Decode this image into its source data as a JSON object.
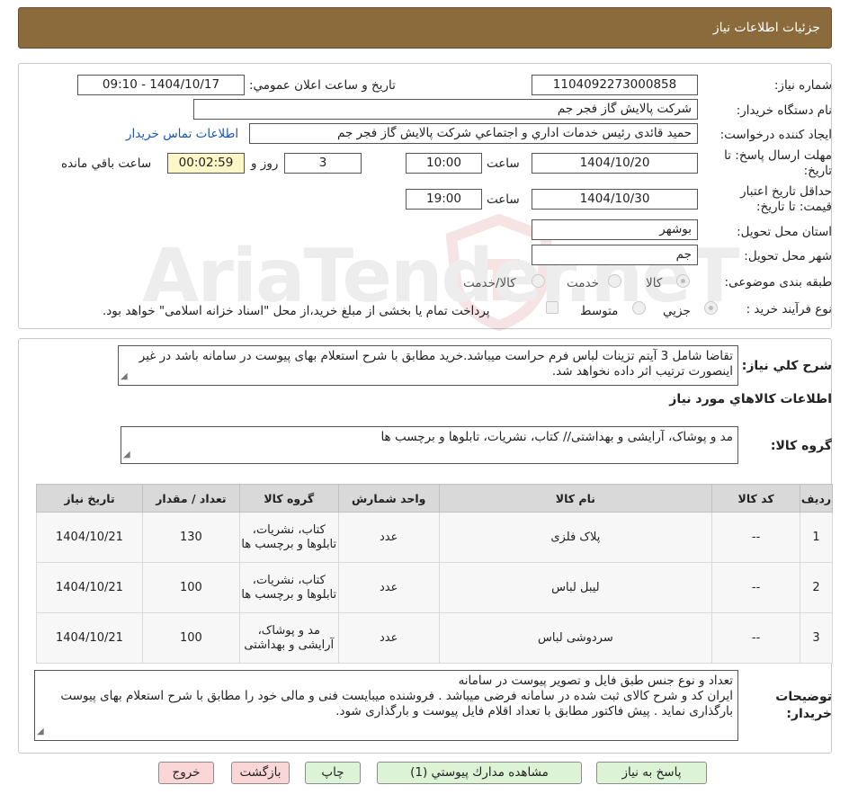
{
  "header": {
    "title": "جزئیات اطلاعات نیاز"
  },
  "form": {
    "need_number_label": "شماره نیاز:",
    "need_number": "1104092273000858",
    "announce_label": "تاریخ و ساعت اعلان عمومي:",
    "announce_value": "1404/10/17 - 09:10",
    "buyer_org_label": "نام دستگاه خريدار:",
    "buyer_org": "شركت پالايش گاز فجر جم",
    "requester_label": "ايجاد كننده درخواست:",
    "requester": "حميد قائدى رئيس خدمات اداري و اجتماعي شركت پالايش گاز فجر جم",
    "contact_link": "اطلاعات تماس خريدار",
    "reply_deadline_label": "مهلت ارسال پاسخ: تا تاریخ:",
    "reply_date": "1404/10/20",
    "time_label": "ساعت",
    "reply_time": "10:00",
    "days_value": "3",
    "days_label": "روز و",
    "remaining_time": "00:02:59",
    "remaining_label": "ساعت باقي مانده",
    "validity_label": "حداقل تاريخ اعتبار قيمت: تا تاريخ:",
    "validity_date": "1404/10/30",
    "validity_time": "19:00",
    "province_label": "استان محل تحويل:",
    "province": "بوشهر",
    "city_label": "شهر محل تحويل:",
    "city": "جم",
    "category_label": "طبقه بندی موضوعی:",
    "category_options": [
      "كالا",
      "خدمت",
      "كالا/خدمت"
    ],
    "process_label": "نوع فرآيند خريد :",
    "process_options": [
      "جزيي",
      "متوسط"
    ],
    "payment_note": "پرداخت تمام يا بخشى از مبلغ خريد،از محل \"اسناد خزانه اسلامى\" خواهد بود."
  },
  "description": {
    "label": "شرح كلي نياز:",
    "text": "تقاضا شامل 3 آیتم تزینات لباس فرم حراست میباشد.خرید مطابق با شرح استعلام بهای پیوست در سامانه باشد در غیر اینصورت ترتیب اثر داده نخواهد شد."
  },
  "goods": {
    "section_title": "اطلاعات كالاهاي مورد نياز",
    "group_label": "گروه كالا:",
    "group_value": "مد و پوشاک، آرایشی و بهداشتی// کتاب، نشریات، تابلوها و برچسب ها",
    "columns": [
      "رديف",
      "كد كالا",
      "نام كالا",
      "واحد شمارش",
      "گروه كالا",
      "تعداد / مقدار",
      "تاريخ نياز"
    ],
    "rows": [
      {
        "row": "1",
        "code": "--",
        "name": "پلاک فلزی",
        "unit": "عدد",
        "group": "کتاب، نشریات، تابلوها و برچسب ها",
        "qty": "130",
        "date": "1404/10/21"
      },
      {
        "row": "2",
        "code": "--",
        "name": "لیبل لباس",
        "unit": "عدد",
        "group": "کتاب، نشریات، تابلوها و برچسب ها",
        "qty": "100",
        "date": "1404/10/21"
      },
      {
        "row": "3",
        "code": "--",
        "name": "سردوشی لباس",
        "unit": "عدد",
        "group": "مد و پوشاک، آرایشی و بهداشتی",
        "qty": "100",
        "date": "1404/10/21"
      }
    ]
  },
  "buyer_notes": {
    "label": "توضيحات خريدار:",
    "line1": "تعداد و نوع جنس طبق فایل و تصویر پیوست در سامانه",
    "line2": "ایران کد و شرح کالای ثبت شده در سامانه فرضی میباشد . فروشنده میبایست فنی و مالی خود را مطابق با شرح استعلام بهای پیوست بارگذاری نماید . پیش فاکتور مطابق با تعداد اقلام فایل پیوست و بارگذاری شود."
  },
  "buttons": {
    "reply": "پاسخ به نياز",
    "attachments": "مشاهده مدارك پيوستي (1)",
    "print": "چاپ",
    "back": "بازگشت",
    "exit": "خروج"
  },
  "watermark": {
    "text": "AriaTender.neT"
  },
  "colors": {
    "header": "#8b6a3c",
    "button_green": "#ddf3d5",
    "button_red": "#fbd6d6",
    "timer_bg": "#fdf6c7",
    "link": "#1a56b8"
  }
}
